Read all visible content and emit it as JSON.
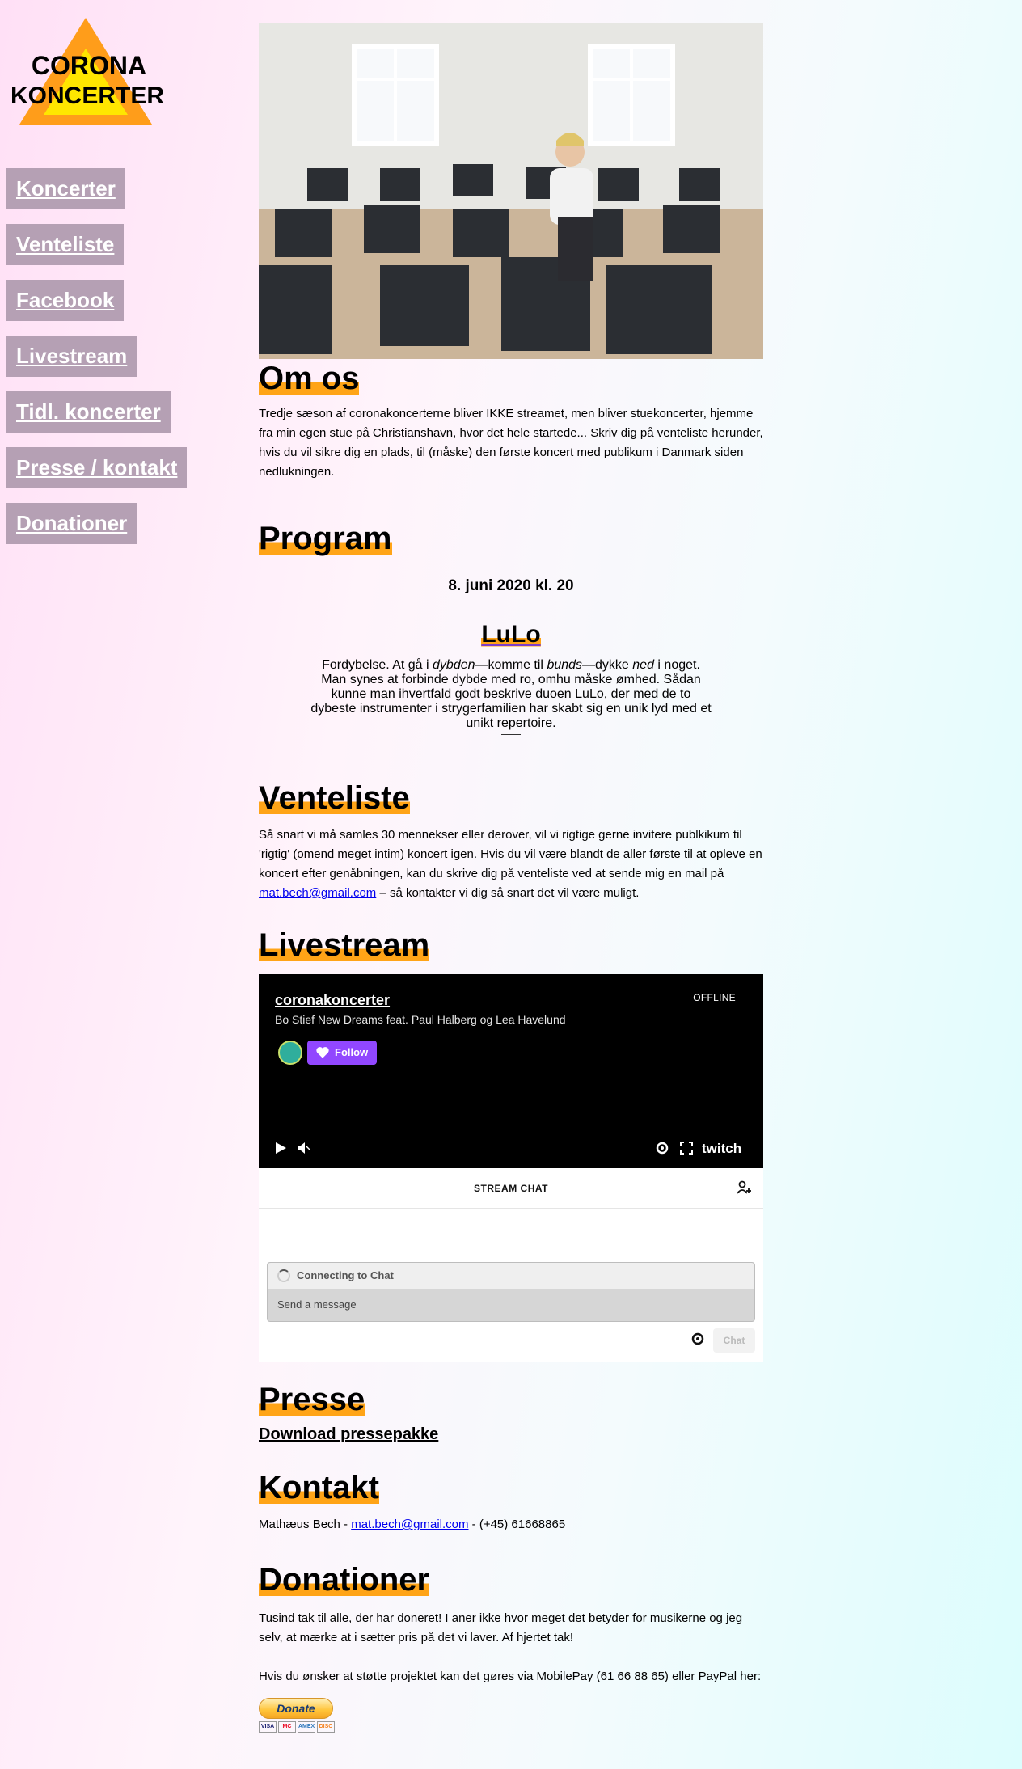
{
  "logo": {
    "line1": "CORONA",
    "line2": "KONCERTER"
  },
  "nav": [
    "Koncerter",
    "Venteliste",
    "Facebook",
    "Livestream",
    "Tidl. koncerter",
    "Presse / kontakt",
    "Donationer"
  ],
  "about": {
    "heading": "Om os",
    "text": "Tredje sæson af coronakoncerterne bliver IKKE streamet, men bliver stuekoncerter, hjemme fra min egen stue på Christianshavn, hvor det hele startede... Skriv dig på venteliste herunder, hvis du vil sikre dig en plads, til (måske) den første koncert med publikum i Danmark siden nedlukningen."
  },
  "program": {
    "heading": "Program",
    "date": "8. juni 2020 kl. 20",
    "artist": "LuLo",
    "desc_parts": [
      "Fordybelse. At gå i ",
      "dybden",
      "—komme til ",
      "bunds",
      "—dykke ",
      "ned",
      " i noget. Man synes at forbinde dybde med ro, omhu måske ømhed. Sådan kunne man ihvertfald godt beskrive duoen LuLo, der med de to dybeste instrumenter i strygerfamilien har skabt sig en unik lyd med et unikt repertoire."
    ]
  },
  "waitlist": {
    "heading": "Venteliste",
    "text": "Så snart vi må samles 30 mennekser eller derover, vil vi rigtige gerne invitere publkikum til 'rigtig' (omend meget intim) koncert igen. Hvis du vil være blandt de aller første til at opleve en koncert efter genåbningen, kan du skrive dig på venteliste ved at sende mig en mail på ",
    "email": "mat.bech@gmail.com",
    "text_after": " – så kontakter vi dig så snart det vil være muligt."
  },
  "livestream": {
    "heading": "Livestream",
    "channel": "coronakoncerter",
    "status": "OFFLINE",
    "stream_title": "Bo Stief New Dreams feat. Paul Halberg og Lea Havelund",
    "follow": "Follow",
    "brand": "twitch",
    "chat_header": "STREAM CHAT",
    "connecting": "Connecting to Chat",
    "placeholder": "Send a message",
    "chat_button": "Chat"
  },
  "press": {
    "heading": "Presse",
    "download": "Download pressepakke"
  },
  "contact": {
    "heading": "Kontakt",
    "name": "Mathæus Bech - ",
    "email": "mat.bech@gmail.com",
    "phone": " - (+45) 61668865"
  },
  "donations": {
    "heading": "Donationer",
    "thanks": "Tusind tak til alle, der har doneret! I aner ikke hvor meget det betyder for musikerne og jeg selv, at mærke at i sætter pris på det vi laver. Af hjertet tak!",
    "support": "Hvis du ønsker at støtte projektet kan det gøres via MobilePay (61 66 88 65) eller PayPal her:",
    "button": "Donate",
    "cards": [
      "VISA",
      "MC",
      "AMEX",
      "DISC"
    ]
  },
  "colors": {
    "accent": "#ffa417",
    "nav_bg": "#b5a0b4",
    "twitch_purple": "#9147ff"
  }
}
